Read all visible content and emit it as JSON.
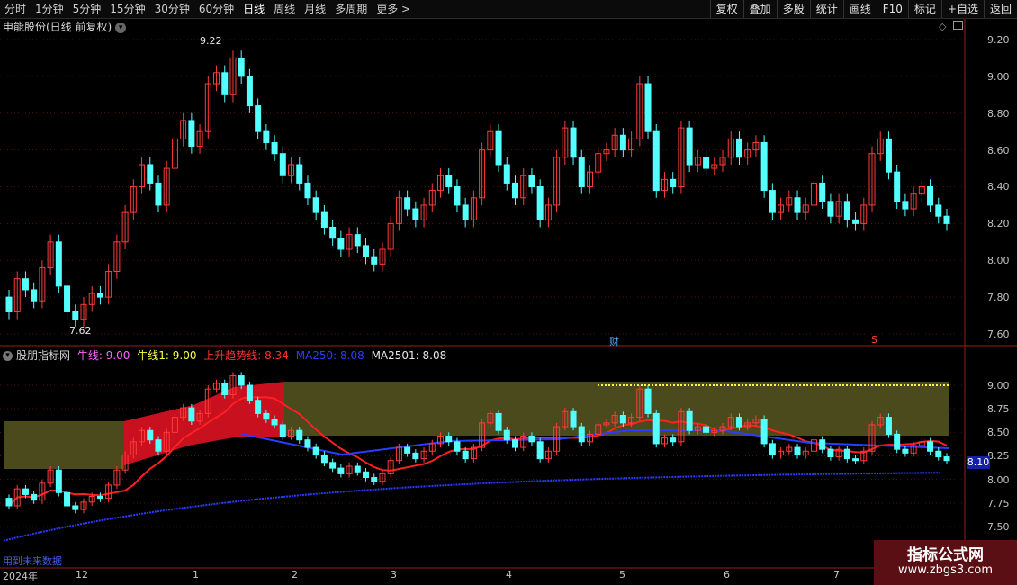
{
  "toolbar": {
    "periods": [
      "分时",
      "1分钟",
      "5分钟",
      "15分钟",
      "30分钟",
      "60分钟",
      "日线",
      "周线",
      "月线",
      "多周期",
      "更多 >"
    ],
    "active_period": "日线",
    "right_buttons": [
      "复权",
      "叠加",
      "多股",
      "统计",
      "画线",
      "F10",
      "标记",
      "+自选",
      "返回"
    ]
  },
  "stock": {
    "title": "申能股份(日线 前复权)",
    "high_label": "9.22",
    "low_label": "7.62",
    "marker_cai": "财",
    "marker_s": "S"
  },
  "price_axis": [
    "9.20",
    "9.00",
    "8.80",
    "8.60",
    "8.40",
    "8.20",
    "8.00",
    "7.80",
    "7.60"
  ],
  "indicator": {
    "name": "股朋指标网",
    "items": [
      {
        "text": "牛线: 9.00",
        "color": "#ff66ff"
      },
      {
        "text": "牛线1: 9.00",
        "color": "#ffff40"
      },
      {
        "text": "上升趋势线: 8.34",
        "color": "#ff3030"
      },
      {
        "text": "MA250: 8.08",
        "color": "#2a3cff"
      },
      {
        "text": "MA2501: 8.08",
        "color": "#e8e8e8"
      }
    ],
    "axis": [
      "9.00",
      "8.75",
      "8.50",
      "8.25",
      "8.00",
      "7.75",
      "7.50"
    ],
    "current_price_tag": "8.10",
    "future_label": "用到未来数据"
  },
  "x_axis": [
    "2024年",
    "12",
    "1",
    "2",
    "3",
    "4",
    "5",
    "6",
    "7"
  ],
  "watermark": {
    "line1": "指标公式网",
    "line2": "www.zbgs3.com"
  },
  "colors": {
    "up": "#ff3b3b",
    "down": "#54ffff",
    "band_olive": "#4a4a1c",
    "band_red": "#c8101e",
    "ma250": "#2b3bff"
  },
  "chart_data": {
    "type": "candlestick",
    "series": [
      {
        "name": "price",
        "open_close_estimated": [
          [
            7.8,
            7.72
          ],
          [
            7.72,
            7.9
          ],
          [
            7.9,
            7.84
          ],
          [
            7.84,
            7.78
          ],
          [
            7.78,
            7.96
          ],
          [
            7.96,
            8.1
          ],
          [
            8.1,
            7.86
          ],
          [
            7.86,
            7.72
          ],
          [
            7.72,
            7.68
          ],
          [
            7.68,
            7.76
          ],
          [
            7.76,
            7.82
          ],
          [
            7.82,
            7.8
          ],
          [
            7.8,
            7.94
          ],
          [
            7.94,
            8.1
          ],
          [
            8.1,
            8.26
          ],
          [
            8.26,
            8.4
          ],
          [
            8.4,
            8.52
          ],
          [
            8.52,
            8.42
          ],
          [
            8.42,
            8.3
          ],
          [
            8.3,
            8.5
          ],
          [
            8.5,
            8.66
          ],
          [
            8.66,
            8.76
          ],
          [
            8.76,
            8.62
          ],
          [
            8.62,
            8.7
          ],
          [
            8.7,
            8.96
          ],
          [
            8.96,
            9.02
          ],
          [
            9.02,
            8.9
          ],
          [
            8.9,
            9.1
          ],
          [
            9.1,
            9.0
          ],
          [
            9.0,
            8.84
          ],
          [
            8.84,
            8.7
          ],
          [
            8.7,
            8.64
          ],
          [
            8.64,
            8.58
          ],
          [
            8.58,
            8.46
          ],
          [
            8.46,
            8.52
          ],
          [
            8.52,
            8.42
          ],
          [
            8.42,
            8.34
          ],
          [
            8.34,
            8.26
          ],
          [
            8.26,
            8.18
          ],
          [
            8.18,
            8.12
          ],
          [
            8.12,
            8.06
          ],
          [
            8.06,
            8.14
          ],
          [
            8.14,
            8.08
          ],
          [
            8.08,
            8.02
          ],
          [
            8.02,
            7.98
          ],
          [
            7.98,
            8.06
          ],
          [
            8.06,
            8.2
          ],
          [
            8.2,
            8.34
          ],
          [
            8.34,
            8.28
          ],
          [
            8.28,
            8.22
          ],
          [
            8.22,
            8.3
          ],
          [
            8.3,
            8.38
          ],
          [
            8.38,
            8.46
          ],
          [
            8.46,
            8.4
          ],
          [
            8.4,
            8.3
          ],
          [
            8.3,
            8.22
          ],
          [
            8.22,
            8.34
          ],
          [
            8.34,
            8.6
          ],
          [
            8.6,
            8.7
          ],
          [
            8.7,
            8.52
          ],
          [
            8.52,
            8.42
          ],
          [
            8.42,
            8.34
          ],
          [
            8.34,
            8.46
          ],
          [
            8.46,
            8.4
          ],
          [
            8.4,
            8.22
          ],
          [
            8.22,
            8.3
          ],
          [
            8.3,
            8.56
          ],
          [
            8.56,
            8.72
          ],
          [
            8.72,
            8.56
          ],
          [
            8.56,
            8.4
          ],
          [
            8.4,
            8.48
          ],
          [
            8.48,
            8.58
          ],
          [
            8.58,
            8.6
          ],
          [
            8.6,
            8.68
          ],
          [
            8.68,
            8.6
          ],
          [
            8.6,
            8.66
          ],
          [
            8.66,
            8.96
          ],
          [
            8.96,
            8.7
          ],
          [
            8.7,
            8.38
          ],
          [
            8.38,
            8.44
          ],
          [
            8.44,
            8.4
          ],
          [
            8.4,
            8.72
          ],
          [
            8.72,
            8.52
          ],
          [
            8.52,
            8.56
          ],
          [
            8.56,
            8.5
          ],
          [
            8.5,
            8.52
          ],
          [
            8.52,
            8.56
          ],
          [
            8.56,
            8.66
          ],
          [
            8.66,
            8.56
          ],
          [
            8.56,
            8.6
          ],
          [
            8.6,
            8.64
          ],
          [
            8.64,
            8.38
          ],
          [
            8.38,
            8.26
          ],
          [
            8.26,
            8.3
          ],
          [
            8.3,
            8.34
          ],
          [
            8.34,
            8.26
          ],
          [
            8.26,
            8.3
          ],
          [
            8.3,
            8.42
          ],
          [
            8.42,
            8.32
          ],
          [
            8.32,
            8.24
          ],
          [
            8.24,
            8.32
          ],
          [
            8.32,
            8.22
          ],
          [
            8.22,
            8.2
          ],
          [
            8.2,
            8.3
          ],
          [
            8.3,
            8.58
          ],
          [
            8.58,
            8.66
          ],
          [
            8.66,
            8.48
          ],
          [
            8.48,
            8.32
          ],
          [
            8.32,
            8.28
          ],
          [
            8.28,
            8.36
          ],
          [
            8.36,
            8.4
          ],
          [
            8.4,
            8.3
          ],
          [
            8.3,
            8.24
          ],
          [
            8.24,
            8.2
          ]
        ]
      }
    ],
    "xlabels": [
      "2024年",
      "12",
      "1",
      "2",
      "3",
      "4",
      "5",
      "6",
      "7"
    ],
    "ylim": [
      7.55,
      9.28
    ]
  }
}
